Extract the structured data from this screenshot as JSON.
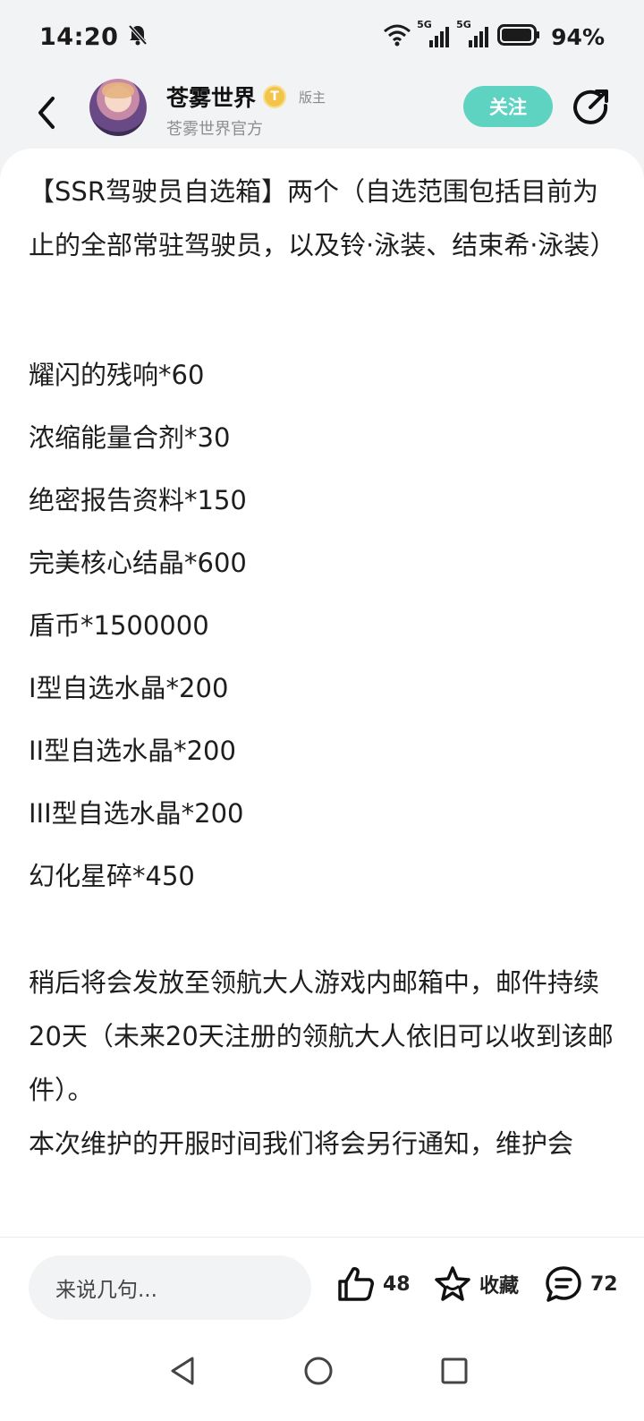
{
  "status_bar": {
    "time": "14:20",
    "network1": "5G",
    "network2": "5G",
    "battery": "94%",
    "icons": [
      "mute-bell-icon",
      "wifi-icon",
      "signal-icon",
      "battery-icon"
    ]
  },
  "header": {
    "author_name": "苍雾世界",
    "badge_letter": "T",
    "role": "版主",
    "subtitle": "苍雾世界官方",
    "follow_label": "关注"
  },
  "post": {
    "intro": "【SSR驾驶员自选箱】两个（自选范围包括目前为止的全部常驻驾驶员，以及铃·泳装、结束希·泳装）",
    "items": [
      "耀闪的残响*60",
      "浓缩能量合剂*30",
      "绝密报告资料*150",
      "完美核心结晶*600",
      "盾币*1500000",
      "I型自选水晶*200",
      "II型自选水晶*200",
      "III型自选水晶*200",
      "幻化星碎*450"
    ],
    "notice": "稍后将会发放至领航大人游戏内邮箱中，邮件持续20天（未来20天注册的领航大人依旧可以收到该邮件）。",
    "notice2": "本次维护的开服时间我们将会另行通知，维护会"
  },
  "bottom_bar": {
    "comment_placeholder": "来说几句...",
    "likes": "48",
    "favorite_label": "收藏",
    "comments": "72"
  },
  "colors": {
    "accent": "#5fd3c1",
    "badge": "#f3c44a",
    "background": "#f2f3f5"
  }
}
